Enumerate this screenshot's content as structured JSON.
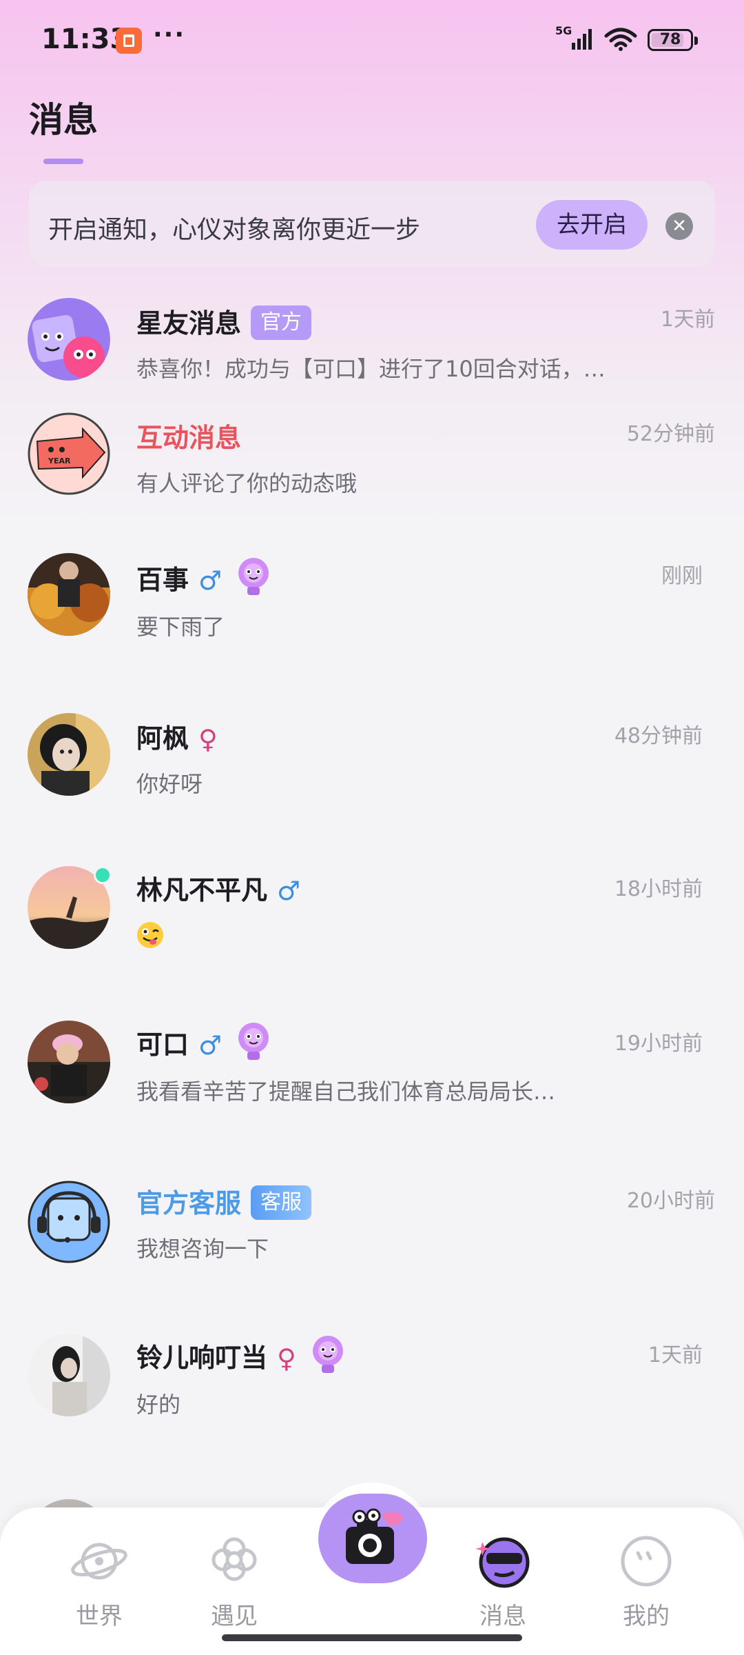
{
  "status_bar": {
    "time": "11:33",
    "dots": "···",
    "network": "5G",
    "battery": "78"
  },
  "header": {
    "title": "消息"
  },
  "banner": {
    "text": "开启通知，心仪对象离你更近一步",
    "button": "去开启",
    "close_icon": "close-icon"
  },
  "messages": [
    {
      "name": "星友消息",
      "tag": "官方",
      "preview": "恭喜你！成功与【可口】进行了10回合对话，…",
      "time": "1天前",
      "avatar": "star-friend-mascot"
    },
    {
      "name": "互动消息",
      "preview": "有人评论了你的动态哦",
      "time": "52分钟前",
      "avatar": "interaction-mascot"
    },
    {
      "name": "百事",
      "gender": "♂",
      "preview": "要下雨了",
      "time": "刚刚",
      "avatar": "user-photo"
    },
    {
      "name": "阿枫",
      "gender": "♀",
      "preview": "你好呀",
      "time": "48分钟前",
      "avatar": "user-photo"
    },
    {
      "name": "林凡不平凡",
      "gender": "♂",
      "preview": "",
      "time": "18小时前",
      "avatar": "user-photo"
    },
    {
      "name": "可口",
      "gender": "♂",
      "preview": "我看看辛苦了提醒自己我们体育总局局长…",
      "time": "19小时前",
      "avatar": "user-photo"
    },
    {
      "name": "官方客服",
      "tag": "客服",
      "preview": "我想咨询一下",
      "time": "20小时前",
      "avatar": "customer-service-mascot"
    },
    {
      "name": "铃儿响叮当",
      "gender": "♀",
      "preview": "好的",
      "time": "1天前",
      "avatar": "user-photo"
    }
  ],
  "tabbar": {
    "tabs": [
      {
        "label": "世界",
        "icon": "planet-icon"
      },
      {
        "label": "遇见",
        "icon": "flower-icon"
      },
      {
        "label": "",
        "icon": "camera-icon"
      },
      {
        "label": "消息",
        "icon": "message-mascot-icon"
      },
      {
        "label": "我的",
        "icon": "profile-icon"
      }
    ],
    "active": "消息"
  },
  "colors": {
    "accent": "#b08ef3",
    "highlight_red": "#e8545c",
    "highlight_blue": "#4d9ae6",
    "male": "#3b8fe0",
    "female": "#d1417e"
  }
}
